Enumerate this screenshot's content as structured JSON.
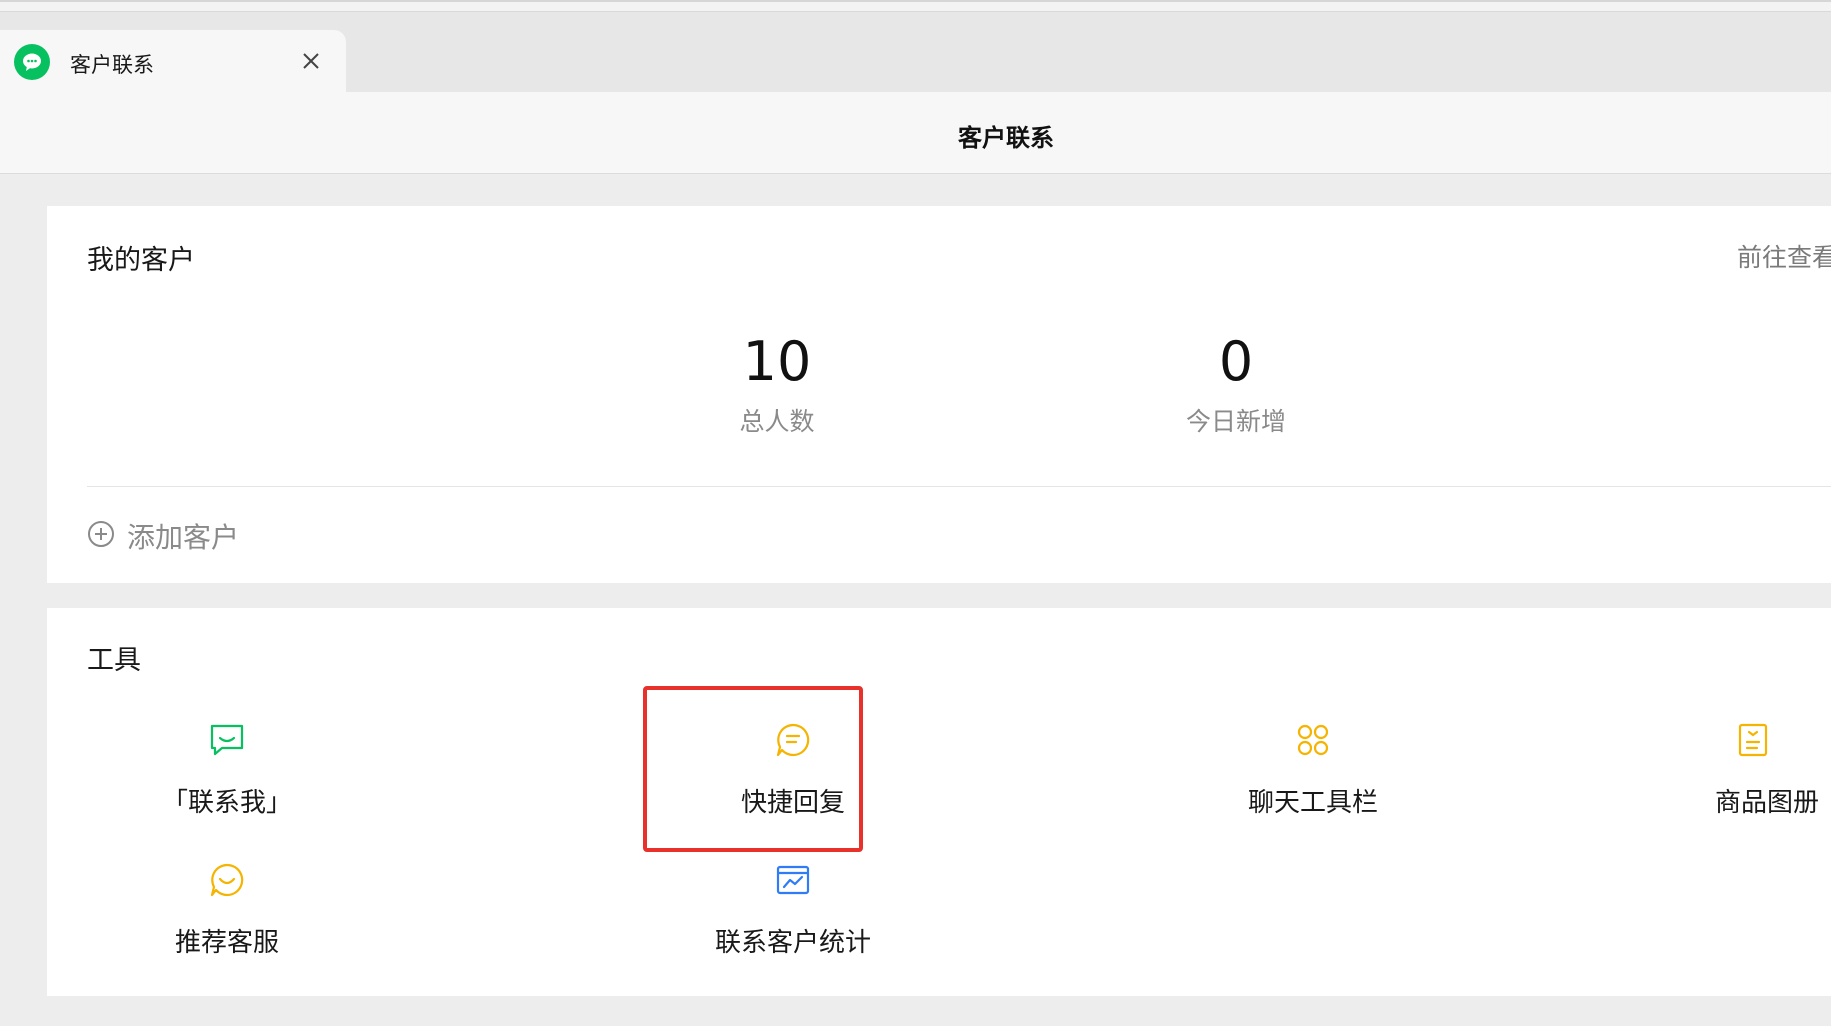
{
  "tab": {
    "title": "客户联系",
    "icon": "wechat-bubble-icon",
    "close_icon": "close-icon"
  },
  "header": {
    "title": "客户联系"
  },
  "customers": {
    "title": "我的客户",
    "go_link": "前往查看",
    "stats": [
      {
        "value": "10",
        "label": "总人数"
      },
      {
        "value": "0",
        "label": "今日新增"
      }
    ],
    "add_label": "添加客户",
    "add_icon": "plus-circle-icon"
  },
  "tools": {
    "title": "工具",
    "items": [
      {
        "label": "「联系我」",
        "icon": "chat-smile-icon",
        "color": "#07c160"
      },
      {
        "label": "快捷回复",
        "icon": "chat-lines-icon",
        "color": "#f5b400"
      },
      {
        "label": "聊天工具栏",
        "icon": "grid-clover-icon",
        "color": "#f5b400"
      },
      {
        "label": "商品图册",
        "icon": "album-icon",
        "color": "#f5b400"
      },
      {
        "label": "推荐客服",
        "icon": "smile-bubble-icon",
        "color": "#f5b400"
      },
      {
        "label": "联系客户统计",
        "icon": "chart-card-icon",
        "color": "#2f7cf6"
      }
    ]
  },
  "colors": {
    "accent_green": "#07c160",
    "highlight_red": "#e8312a"
  }
}
